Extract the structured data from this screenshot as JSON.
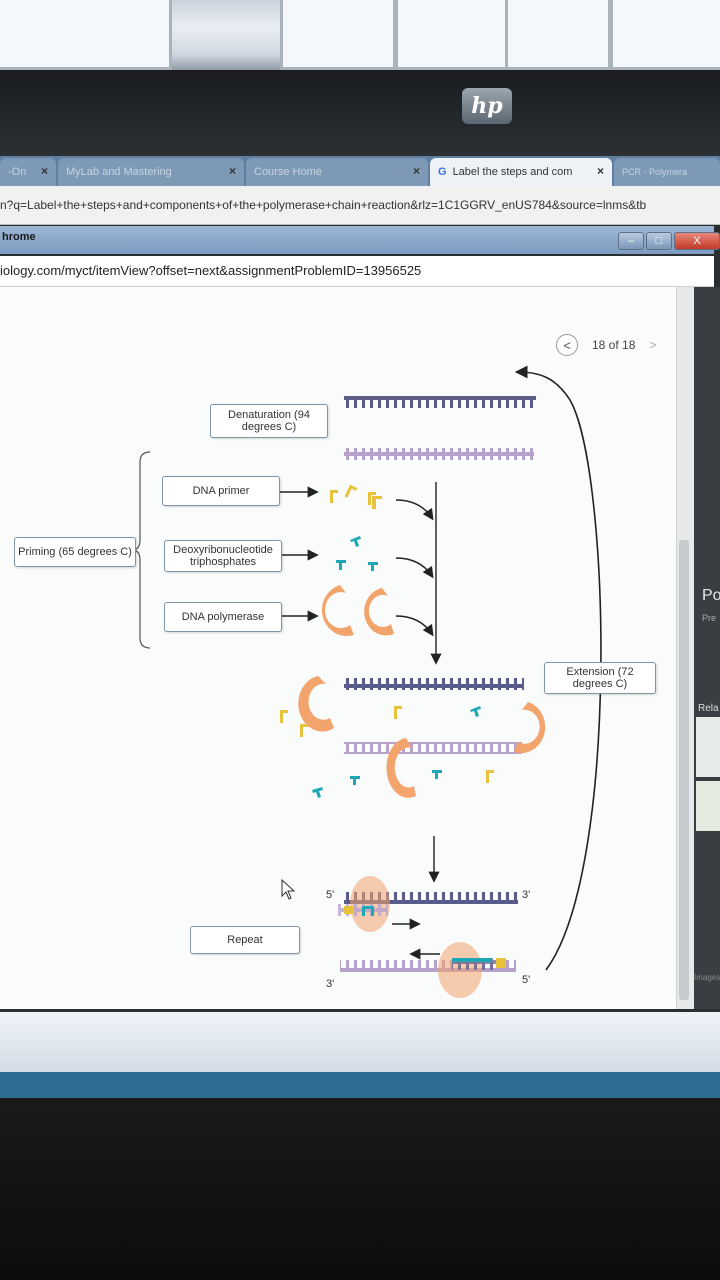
{
  "browser": {
    "tabs": [
      {
        "label": "-On",
        "active": false
      },
      {
        "label": "MyLab and Mastering",
        "active": false
      },
      {
        "label": "Course Home",
        "active": false
      },
      {
        "label": "Label the steps and com",
        "active": true
      },
      {
        "label": "PCR - Polymera",
        "active": false
      }
    ],
    "close_glyph": "×",
    "url": "n?q=Label+the+steps+and+components+of+the+polymerase+chain+reaction&rlz=1C1GGRV_enUS784&source=lnms&tb"
  },
  "inner_window": {
    "title": "hrome",
    "url": "iology.com/myct/itemView?offset=next&assignmentProblemID=13956525",
    "buttons": {
      "minimize": "–",
      "maximize": "□",
      "close": "X"
    }
  },
  "brand": {
    "logo_text": "hp"
  },
  "nav": {
    "prev": "<",
    "counter": "18 of 18",
    "next": ">"
  },
  "diagram": {
    "labels": {
      "denaturation": "Denaturation (94 degrees C)",
      "dna_primer": "DNA primer",
      "priming": "Priming (65 degrees C)",
      "deoxy": "Deoxyribonucleotide triphosphates",
      "polymerase": "DNA polymerase",
      "extension": "Extension (72 degrees C)",
      "repeat": "Repeat"
    },
    "strand_ends": {
      "top_5": "5'",
      "top_3": "3'",
      "bottom_3": "3'",
      "bottom_5": "5'"
    }
  },
  "side_panel": {
    "letter": "Po",
    "sub": "Pre",
    "rela": "Rela",
    "images": "Images"
  },
  "colors": {
    "strand_dark": "#5b5b8a",
    "strand_light": "#b7a2cc",
    "polymerase": "#f3a46d",
    "primer": "#e8c23a",
    "nucleotide": "#1ea8b5",
    "label_border": "#7f95ab"
  }
}
